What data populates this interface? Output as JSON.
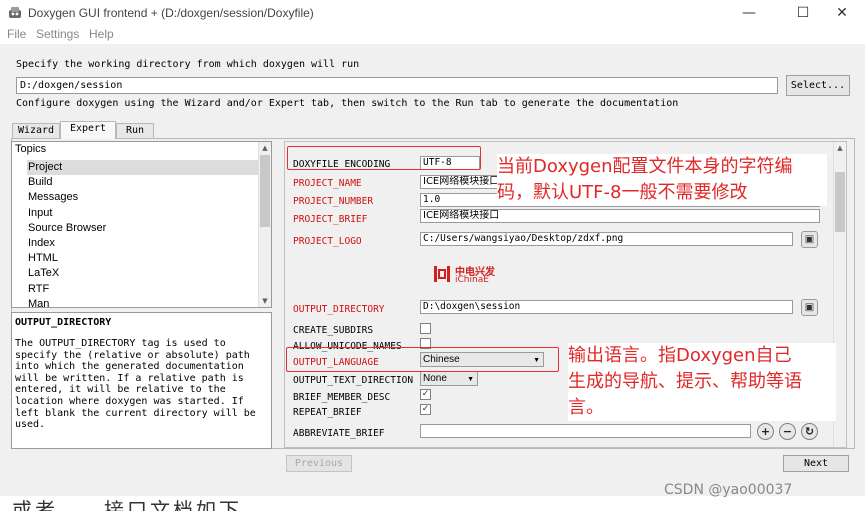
{
  "window": {
    "title": "Doxygen GUI frontend + (D:/doxgen/session/Doxyfile)",
    "minimize": "—",
    "maximize": "☐",
    "close": "✕"
  },
  "menu": [
    "File",
    "Settings",
    "Help"
  ],
  "workdir": {
    "prompt": "Specify the working directory from which doxygen will run",
    "value": "D:/doxgen/session",
    "select_label": "Select...",
    "instructions": "Configure doxygen using the Wizard and/or Expert tab, then switch to the Run tab to generate the documentation"
  },
  "tabs": [
    {
      "label": "Wizard",
      "active": false
    },
    {
      "label": "Expert",
      "active": true
    },
    {
      "label": "Run",
      "active": false
    }
  ],
  "topics": {
    "header": "Topics",
    "items": [
      "Project",
      "Build",
      "Messages",
      "Input",
      "Source Browser",
      "Index",
      "HTML",
      "LaTeX",
      "RTF",
      "Man"
    ],
    "selected": "Project"
  },
  "help": {
    "title": "OUTPUT_DIRECTORY",
    "body": "The OUTPUT_DIRECTORY tag is used to specify the (relative or absolute) path into which the generated documentation will be written. If a relative path is entered, it will be relative to the location where doxygen was started. If left blank the current directory will be used."
  },
  "options": {
    "doxyfile_encoding": {
      "label": "DOXYFILE_ENCODING",
      "value": "UTF-8"
    },
    "project_name": {
      "label": "PROJECT_NAME",
      "value": "ICE网络模块接口"
    },
    "project_number": {
      "label": "PROJECT_NUMBER",
      "value": "1.0"
    },
    "project_brief": {
      "label": "PROJECT_BRIEF",
      "value": "ICE网络模块接口"
    },
    "project_logo": {
      "label": "PROJECT_LOGO",
      "value": "C:/Users/wangsiyao/Desktop/zdxf.png"
    },
    "logo": {
      "cn": "中电兴发",
      "en": "iChinaE"
    },
    "output_directory": {
      "label": "OUTPUT_DIRECTORY",
      "value": "D:\\doxgen\\session"
    },
    "create_subdirs": {
      "label": "CREATE_SUBDIRS",
      "checked": false
    },
    "allow_unicode_names": {
      "label": "ALLOW_UNICODE_NAMES",
      "checked": false
    },
    "output_language": {
      "label": "OUTPUT_LANGUAGE",
      "value": "Chinese"
    },
    "output_text_direction": {
      "label": "OUTPUT_TEXT_DIRECTION",
      "value": "None"
    },
    "brief_member_desc": {
      "label": "BRIEF_MEMBER_DESC",
      "checked": true
    },
    "repeat_brief": {
      "label": "REPEAT_BRIEF",
      "checked": true
    },
    "abbreviate_brief": {
      "label": "ABBREVIATE_BRIEF",
      "value": ""
    }
  },
  "annotations": {
    "encoding_note": [
      "当前Doxygen配置文件本身的字符编",
      "码，默认UTF-8一般不需要修改"
    ],
    "language_note": [
      "输出语言。指Doxygen自己",
      "生成的导航、提示、帮助等语",
      "言。"
    ]
  },
  "nav": {
    "previous": "Previous",
    "next": "Next"
  },
  "watermark": "CSDN @yao00037",
  "truncated_caption": "或者……接口文档如下"
}
